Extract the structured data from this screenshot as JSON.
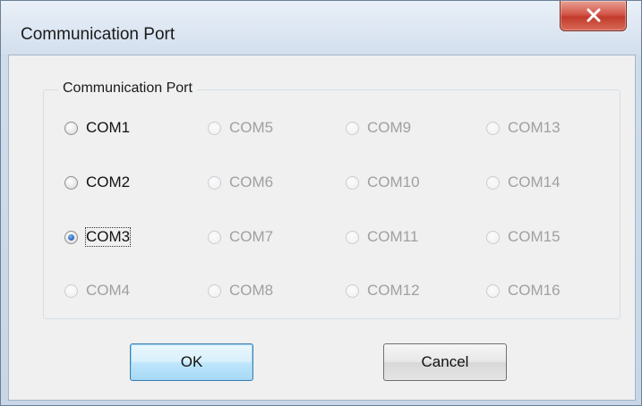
{
  "window": {
    "title": "Communication Port"
  },
  "group": {
    "label": "Communication Port"
  },
  "ports": [
    {
      "label": "COM1",
      "enabled": true,
      "checked": false
    },
    {
      "label": "COM2",
      "enabled": true,
      "checked": false
    },
    {
      "label": "COM3",
      "enabled": true,
      "checked": true
    },
    {
      "label": "COM4",
      "enabled": false,
      "checked": false
    },
    {
      "label": "COM5",
      "enabled": false,
      "checked": false
    },
    {
      "label": "COM6",
      "enabled": false,
      "checked": false
    },
    {
      "label": "COM7",
      "enabled": false,
      "checked": false
    },
    {
      "label": "COM8",
      "enabled": false,
      "checked": false
    },
    {
      "label": "COM9",
      "enabled": false,
      "checked": false
    },
    {
      "label": "COM10",
      "enabled": false,
      "checked": false
    },
    {
      "label": "COM11",
      "enabled": false,
      "checked": false
    },
    {
      "label": "COM12",
      "enabled": false,
      "checked": false
    },
    {
      "label": "COM13",
      "enabled": false,
      "checked": false
    },
    {
      "label": "COM14",
      "enabled": false,
      "checked": false
    },
    {
      "label": "COM15",
      "enabled": false,
      "checked": false
    },
    {
      "label": "COM16",
      "enabled": false,
      "checked": false
    }
  ],
  "buttons": {
    "ok_label": "OK",
    "cancel_label": "Cancel"
  },
  "icons": {
    "close": "close-icon",
    "radio": "radio-icon"
  },
  "colors": {
    "close_button": "#c9473a",
    "default_button_border": "#3c7fb1",
    "disabled_text": "#a0a0a0"
  }
}
